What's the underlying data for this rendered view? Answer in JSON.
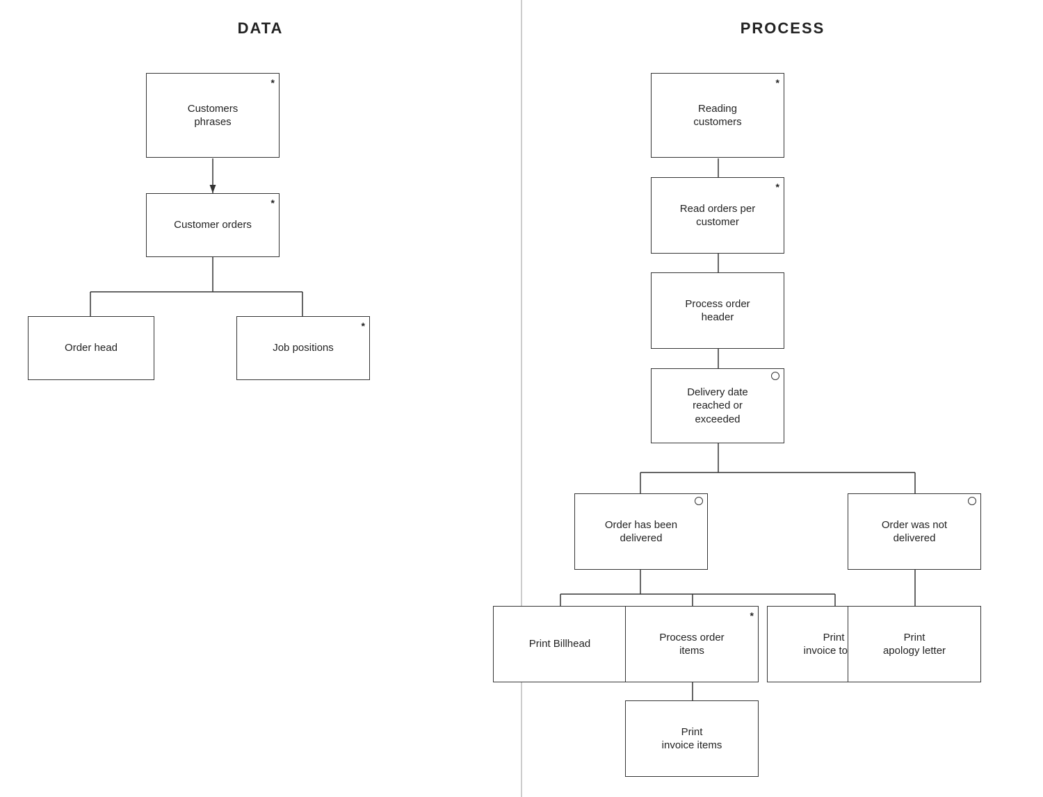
{
  "left_panel": {
    "title": "DATA",
    "nodes": {
      "customers_phrases": {
        "label": "Customers\nphrases",
        "marker": "*"
      },
      "customer_orders": {
        "label": "Customer orders",
        "marker": "*"
      },
      "order_head": {
        "label": "Order head",
        "marker": ""
      },
      "job_positions": {
        "label": "Job positions",
        "marker": "*"
      }
    }
  },
  "right_panel": {
    "title": "PROCESS",
    "nodes": {
      "reading_customers": {
        "label": "Reading\ncustomers",
        "marker": "*"
      },
      "read_orders_per_customer": {
        "label": "Read orders per\ncustomer",
        "marker": "*"
      },
      "process_order_header": {
        "label": "Process order\nheader",
        "marker": ""
      },
      "delivery_date": {
        "label": "Delivery date\nreached or\nexceeded",
        "circle": true
      },
      "order_delivered": {
        "label": "Order has been\ndelivered",
        "circle": true
      },
      "order_not_delivered": {
        "label": "Order was not\ndelivered",
        "circle": true
      },
      "print_billhead": {
        "label": "Print Billhead",
        "marker": ""
      },
      "process_order_items": {
        "label": "Process order\nitems",
        "marker": "*"
      },
      "print_invoice_totals": {
        "label": "Print\ninvoice totals",
        "marker": ""
      },
      "print_apology_letter": {
        "label": "Print\napology letter",
        "marker": ""
      },
      "print_invoice_items": {
        "label": "Print\ninvoice items",
        "marker": ""
      }
    }
  }
}
